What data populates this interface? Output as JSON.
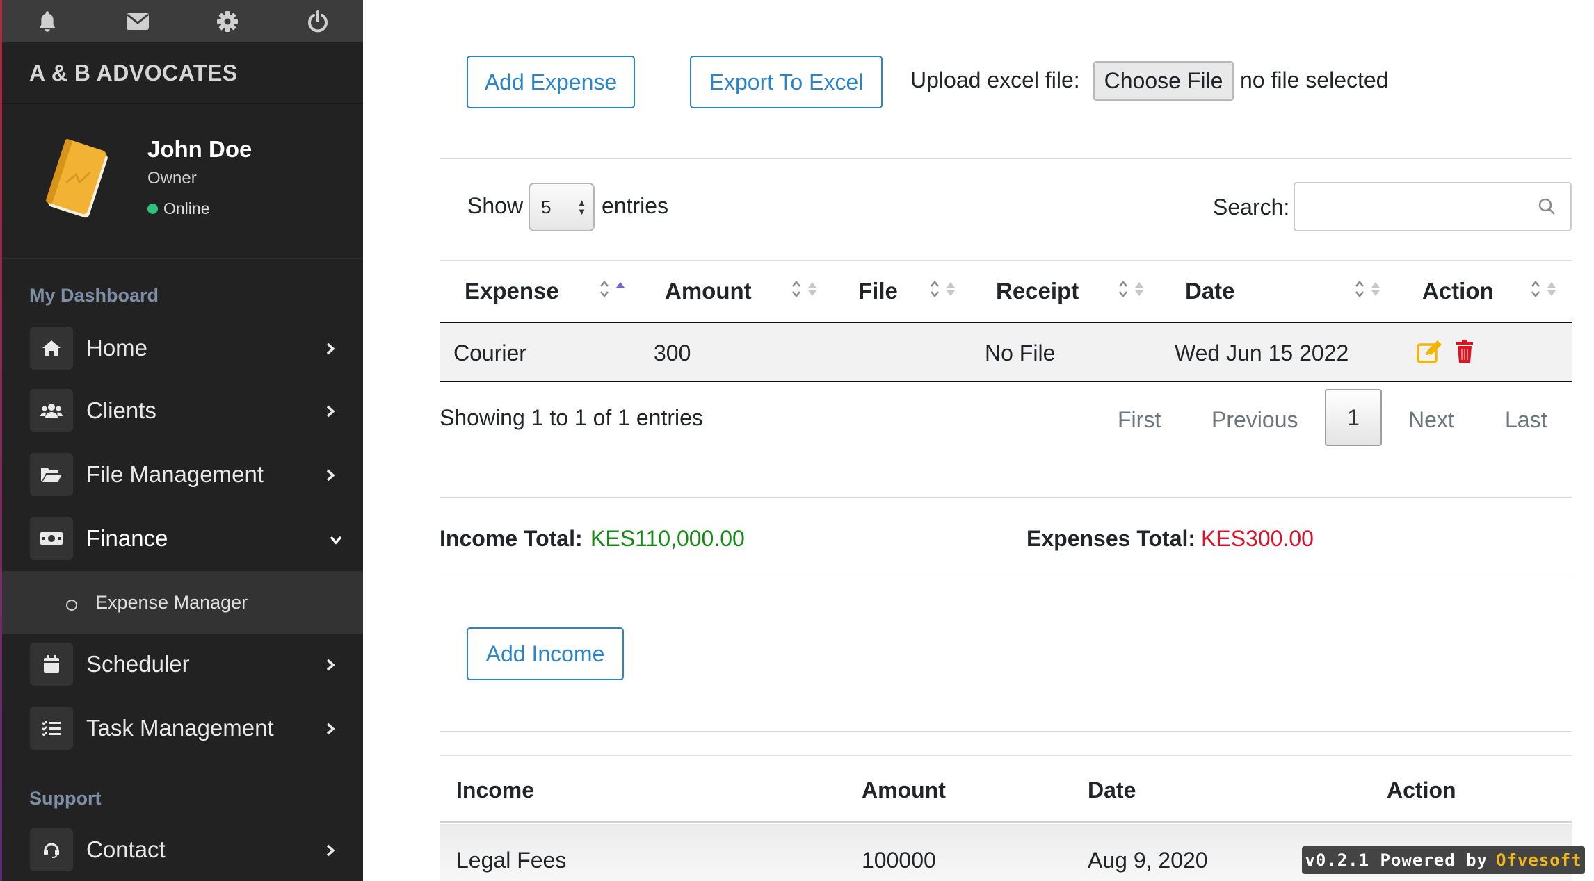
{
  "sidebar": {
    "brand": "A & B ADVOCATES",
    "user": {
      "name": "John Doe",
      "role": "Owner",
      "status": "Online"
    },
    "sections": {
      "dashboard": "My Dashboard",
      "support": "Support"
    },
    "items": [
      {
        "label": "Home",
        "icon": "home-icon"
      },
      {
        "label": "Clients",
        "icon": "users-icon"
      },
      {
        "label": "File Management",
        "icon": "folder-open-icon"
      },
      {
        "label": "Finance",
        "icon": "money-icon"
      },
      {
        "label": "Scheduler",
        "icon": "calendar-icon"
      },
      {
        "label": "Task Management",
        "icon": "tasks-icon"
      },
      {
        "label": "Contact",
        "icon": "headset-icon"
      }
    ],
    "subitem": "Expense Manager"
  },
  "toolbar": {
    "add_expense": "Add Expense",
    "export": "Export To Excel",
    "upload_label": "Upload excel file:",
    "choose_file": "Choose File",
    "no_file": "no file selected"
  },
  "table_controls": {
    "show": "Show",
    "entries_value": "5",
    "entries": "entries",
    "search_label": "Search:",
    "search_value": ""
  },
  "expense_table": {
    "headers": [
      "Expense",
      "Amount",
      "File",
      "Receipt",
      "Date",
      "Action"
    ],
    "rows": [
      {
        "expense": "Courier",
        "amount": "300",
        "file": "",
        "receipt": "No File",
        "date": "Wed Jun 15 2022"
      }
    ]
  },
  "pagination": {
    "info": "Showing 1 to 1 of 1 entries",
    "first": "First",
    "previous": "Previous",
    "current": "1",
    "next": "Next",
    "last": "Last"
  },
  "totals": {
    "income_label": "Income Total:",
    "income_value": "KES110,000.00",
    "expenses_label": "Expenses Total:",
    "expenses_value": "KES300.00",
    "income_color": "#168a16",
    "expenses_color": "#d9122a"
  },
  "income": {
    "add_button": "Add Income",
    "headers": [
      "Income",
      "Amount",
      "Date",
      "Action"
    ],
    "rows": [
      {
        "income": "Legal Fees",
        "amount": "100000",
        "date": "Aug 9, 2020"
      }
    ]
  },
  "footer": {
    "version": "v0.2.1 Powered by",
    "brand": "Ofvesoft"
  },
  "colors": {
    "accent": "#2a84c8",
    "sidebar_bg": "#222222",
    "edit": "#f4b400",
    "delete": "#e0141e"
  }
}
